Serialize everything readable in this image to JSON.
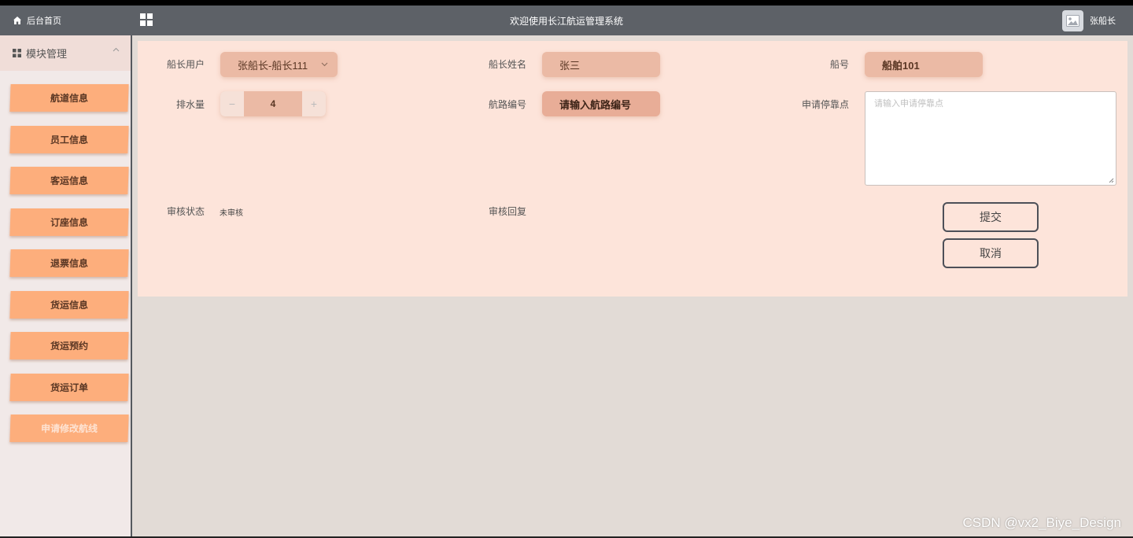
{
  "header": {
    "home_label": "后台首页",
    "welcome_text": "欢迎使用长江航运管理系统",
    "user_name": "张船长"
  },
  "sidebar": {
    "module_title": "模块管理",
    "items": [
      {
        "label": "航道信息"
      },
      {
        "label": "员工信息"
      },
      {
        "label": "客运信息"
      },
      {
        "label": "订座信息"
      },
      {
        "label": "退票信息"
      },
      {
        "label": "货运信息"
      },
      {
        "label": "货运预约"
      },
      {
        "label": "货运订单"
      },
      {
        "label": "申请修改航线",
        "active": true
      }
    ]
  },
  "form": {
    "captain_user_label": "船长用户",
    "captain_user_value": "张船长-船长111",
    "captain_name_label": "船长姓名",
    "captain_name_value": "张三",
    "ship_no_label": "船号",
    "ship_no_value": "船舶101",
    "displacement_label": "排水量",
    "displacement_value": "4",
    "route_no_label": "航路编号",
    "route_no_placeholder": "请输入航路编号",
    "dock_label": "申请停靠点",
    "dock_placeholder": "请输入申请停靠点",
    "review_status_label": "审核状态",
    "review_status_value": "未审核",
    "review_reply_label": "审核回复",
    "submit_label": "提交",
    "cancel_label": "取消"
  },
  "watermark": "CSDN @vx2_Biye_Design",
  "colors": {
    "header_bg": "#5d6167",
    "menu_item_bg": "#fdae7c",
    "panel_bg": "#fde4da",
    "field_bg": "#ebbaa5",
    "sidebar_bg": "#f1e9e8"
  },
  "icons": {
    "home": "home-icon",
    "grid": "grid-icon",
    "avatar": "image-icon",
    "module": "grid-small-icon",
    "collapse": "chevron-up-icon",
    "select": "chevron-down-icon"
  }
}
